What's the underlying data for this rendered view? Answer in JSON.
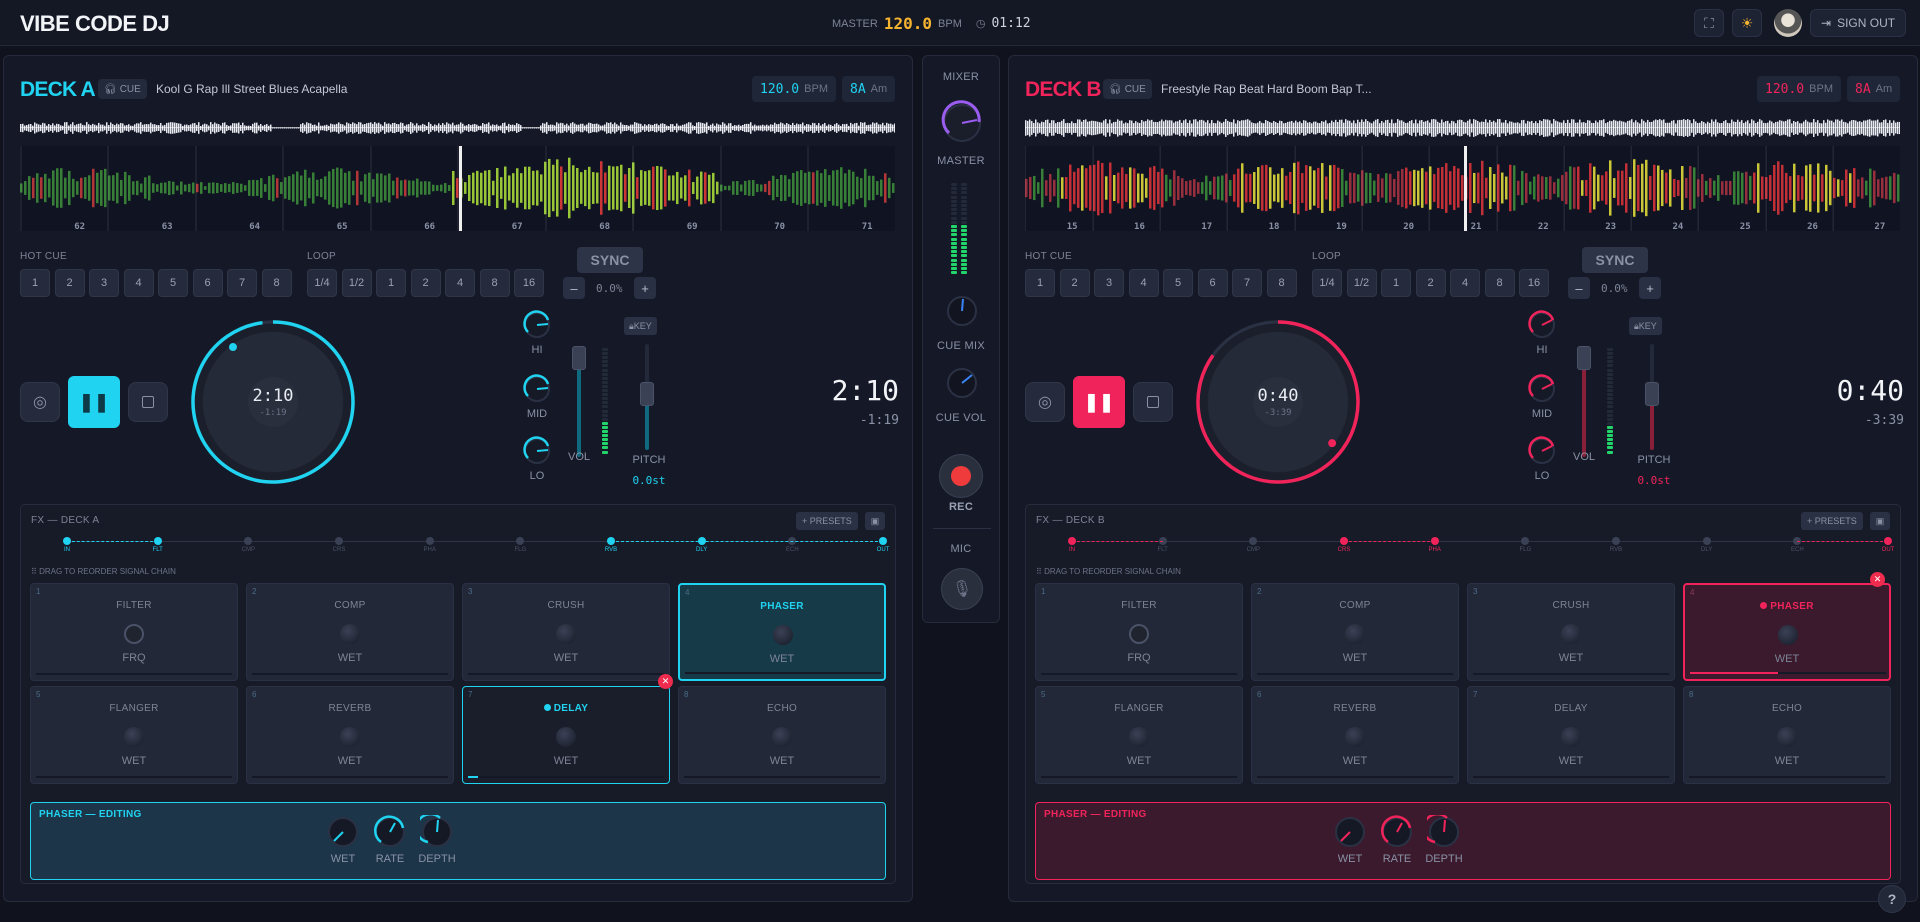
{
  "app": {
    "title": "VIBE CODE DJ"
  },
  "header": {
    "master_label": "MASTER",
    "master_bpm": "120.0",
    "bpm_unit": "BPM",
    "clock": "01:12",
    "sign_out": "SIGN OUT"
  },
  "mixer": {
    "title": "MIXER",
    "master": "MASTER",
    "cue_mix": "CUE MIX",
    "cue_vol": "CUE VOL",
    "rec": "REC",
    "mic": "MIC"
  },
  "deckA": {
    "title": "DECK A",
    "accent": "#20d3f0",
    "cue": "CUE",
    "track": "Kool G Rap Ill Street Blues Acapella",
    "bpm": "120.0",
    "bpm_unit": "BPM",
    "key": "8A",
    "key_mode": "Am",
    "beats": [
      "62",
      "63",
      "64",
      "65",
      "66",
      "67",
      "68",
      "69",
      "70",
      "71"
    ],
    "hot_cue_label": "HOT CUE",
    "hot_cues": [
      "1",
      "2",
      "3",
      "4",
      "5",
      "6",
      "7",
      "8"
    ],
    "loop_label": "LOOP",
    "loops": [
      "1/4",
      "1/2",
      "1",
      "2",
      "4",
      "8",
      "16"
    ],
    "sync": "SYNC",
    "pitch_minus": "–",
    "pitch_plus": "+",
    "pitch_value": "0.0%",
    "platter_time": "2:10",
    "platter_rem": "-1:19",
    "time": "2:10",
    "remaining": "-1:19",
    "eq": {
      "hi": "HI",
      "mid": "MID",
      "lo": "LO",
      "vol": "VOL",
      "pitch": "PITCH",
      "key_lock": "KEY",
      "semitones": "0.0st"
    },
    "fx_title": "FX — DECK A",
    "presets": "+ PRESETS",
    "drag_hint": "DRAG TO REORDER SIGNAL CHAIN",
    "chain": [
      "IN",
      "FLT",
      "CMP",
      "CRS",
      "PHA",
      "FLG",
      "RVB",
      "DLY",
      "ECH",
      "OUT"
    ],
    "fx": [
      {
        "num": "1",
        "name": "FILTER",
        "param": "FRQ"
      },
      {
        "num": "2",
        "name": "COMP",
        "param": "WET"
      },
      {
        "num": "3",
        "name": "CRUSH",
        "param": "WET"
      },
      {
        "num": "4",
        "name": "PHASER",
        "param": "WET"
      },
      {
        "num": "5",
        "name": "FLANGER",
        "param": "WET"
      },
      {
        "num": "6",
        "name": "REVERB",
        "param": "WET"
      },
      {
        "num": "7",
        "name": "DELAY",
        "param": "WET"
      },
      {
        "num": "8",
        "name": "ECHO",
        "param": "WET"
      }
    ],
    "editing": "PHASER — EDITING",
    "edit_params": [
      "WET",
      "RATE",
      "DEPTH"
    ]
  },
  "deckB": {
    "title": "DECK B",
    "accent": "#f0245a",
    "cue": "CUE",
    "track": "Freestyle Rap Beat Hard Boom Bap T...",
    "bpm": "120.0",
    "bpm_unit": "BPM",
    "key": "8A",
    "key_mode": "Am",
    "beats": [
      "15",
      "16",
      "17",
      "18",
      "19",
      "20",
      "21",
      "22",
      "23",
      "24",
      "25",
      "26",
      "27"
    ],
    "hot_cue_label": "HOT CUE",
    "hot_cues": [
      "1",
      "2",
      "3",
      "4",
      "5",
      "6",
      "7",
      "8"
    ],
    "loop_label": "LOOP",
    "loops": [
      "1/4",
      "1/2",
      "1",
      "2",
      "4",
      "8",
      "16"
    ],
    "sync": "SYNC",
    "pitch_minus": "–",
    "pitch_plus": "+",
    "pitch_value": "0.0%",
    "platter_time": "0:40",
    "platter_rem": "-3:39",
    "time": "0:40",
    "remaining": "-3:39",
    "eq": {
      "hi": "HI",
      "mid": "MID",
      "lo": "LO",
      "vol": "VOL",
      "pitch": "PITCH",
      "key_lock": "KEY",
      "semitones": "0.0st"
    },
    "fx_title": "FX — DECK B",
    "presets": "+ PRESETS",
    "drag_hint": "DRAG TO REORDER SIGNAL CHAIN",
    "chain": [
      "IN",
      "FLT",
      "CMP",
      "CRS",
      "PHA",
      "FLG",
      "RVB",
      "DLY",
      "ECH",
      "OUT"
    ],
    "fx": [
      {
        "num": "1",
        "name": "FILTER",
        "param": "FRQ"
      },
      {
        "num": "2",
        "name": "COMP",
        "param": "WET"
      },
      {
        "num": "3",
        "name": "CRUSH",
        "param": "WET"
      },
      {
        "num": "4",
        "name": "PHASER",
        "param": "WET"
      },
      {
        "num": "5",
        "name": "FLANGER",
        "param": "WET"
      },
      {
        "num": "6",
        "name": "REVERB",
        "param": "WET"
      },
      {
        "num": "7",
        "name": "DELAY",
        "param": "WET"
      },
      {
        "num": "8",
        "name": "ECHO",
        "param": "WET"
      }
    ],
    "editing": "PHASER — EDITING",
    "edit_params": [
      "WET",
      "RATE",
      "DEPTH"
    ]
  },
  "help": "?"
}
